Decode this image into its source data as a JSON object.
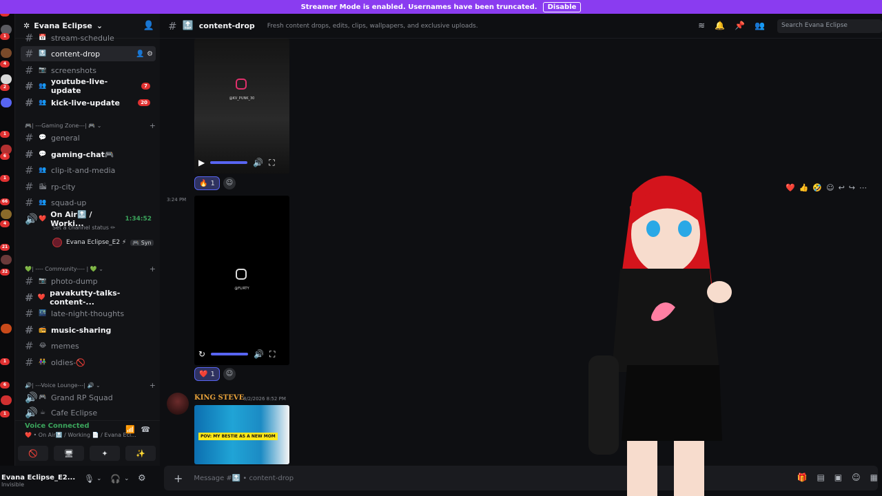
{
  "banner": {
    "text": "Streamer Mode is enabled. Usernames have been truncated.",
    "button": "Disable"
  },
  "rail": {
    "badges": [
      "10",
      "1",
      "4",
      "2",
      "1",
      "6",
      "1",
      "66",
      "4",
      "21",
      "32",
      "1",
      "6",
      "1"
    ]
  },
  "server": {
    "name": "Evana Eclipse"
  },
  "channels": [
    {
      "name": "stream-schedule",
      "emoji": "📅"
    },
    {
      "name": "content-drop",
      "emoji": "🔝",
      "active": true
    },
    {
      "name": "screenshots",
      "emoji": "📷"
    },
    {
      "name": "youtube-live-update",
      "emoji": "👥",
      "bold": true,
      "badge": "7"
    },
    {
      "name": "kick-live-update",
      "emoji": "👥",
      "bold": true,
      "badge": "20"
    },
    {
      "name": "general",
      "emoji": "💬"
    },
    {
      "name": "gaming-chat🎮",
      "emoji": "💬",
      "bold": true
    },
    {
      "name": "clip-it-and-media",
      "emoji": "👥"
    },
    {
      "name": "rp-city",
      "emoji": "🏙"
    },
    {
      "name": "squad-up",
      "emoji": "👥"
    },
    {
      "name": "On Air🔝 / Worki...",
      "emoji": "❤️",
      "bold": true,
      "voice": true,
      "timer": "1:34:52"
    },
    {
      "name": "photo-dump",
      "emoji": "📷"
    },
    {
      "name": "pavakutty-talks-content-...",
      "emoji": "❤️",
      "bold": true
    },
    {
      "name": "late-night-thoughts",
      "emoji": "🌃"
    },
    {
      "name": "music-sharing",
      "emoji": "📻",
      "bold": true
    },
    {
      "name": "memes",
      "emoji": "😂"
    },
    {
      "name": "oldies-🚫",
      "emoji": "👫"
    },
    {
      "name": "Grand RP Squad",
      "emoji": "🎮",
      "voice": true
    },
    {
      "name": "Cafe Eclipse",
      "emoji": "☕",
      "voice": true
    }
  ],
  "categories": [
    {
      "label": "🎮| ---Gaming Zone---| 🎮"
    },
    {
      "label": "💚| ---- Community---- | 💚"
    },
    {
      "label": "🔊| ---Voice Lounge---| 🔊"
    }
  ],
  "voice_extra": {
    "set_status": "Set a channel status ✏",
    "user": "Evana Eclipse_E2 ⚡",
    "user_tag": "🎮 Syn"
  },
  "vc_panel": {
    "title": "Voice Connected",
    "sub": "❤️ • On Air🔝 / Working 📄 / Evana Ecl..."
  },
  "user_panel": {
    "name": "Evana Eclipse_E2...",
    "status": "Invisible"
  },
  "channel_header": {
    "name": "content-drop",
    "prefix": "🔝",
    "topic": "Fresh content drops, edits, clips, wallpapers, and exclusive uploads."
  },
  "search": {
    "placeholder": "Search Evana Eclipse"
  },
  "messages": {
    "video1": {
      "caption": "@KV_PUNK_30",
      "reaction_emoji": "🔥",
      "reaction_count": "1"
    },
    "video2": {
      "time": "3:24 PM",
      "caption": "@FLIRTY",
      "reaction_emoji": "❤️",
      "reaction_count": "1"
    },
    "post3": {
      "author": "KING STEVE",
      "date": "8/2/2026 8:52 PM",
      "thumb_caption": "POV: MY BESTIE AS A NEW MOM"
    }
  },
  "composer": {
    "placeholder": "Message #🔝 • content-drop"
  },
  "colors": {
    "banner": "#8a3cf0",
    "accent": "#5865f2",
    "voice_green": "#3ba55c",
    "badge_red": "#e03131"
  }
}
